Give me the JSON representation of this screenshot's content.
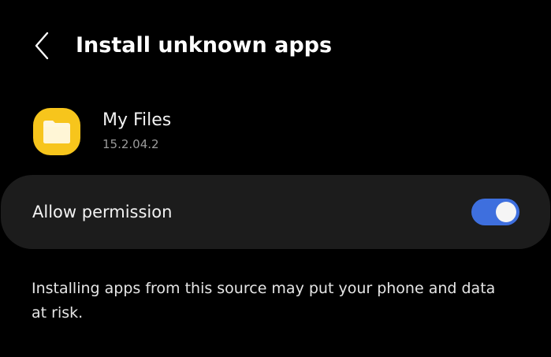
{
  "header": {
    "title": "Install unknown apps",
    "back_icon": "chevron-left-icon"
  },
  "app": {
    "name": "My Files",
    "version": "15.2.04.2",
    "icon": "folder-icon",
    "icon_color": "#f7c51c"
  },
  "permission": {
    "label": "Allow permission",
    "enabled": true,
    "toggle_color": "#3e6fde"
  },
  "warning": {
    "text": "Installing apps from this source may put your phone and data at risk."
  }
}
